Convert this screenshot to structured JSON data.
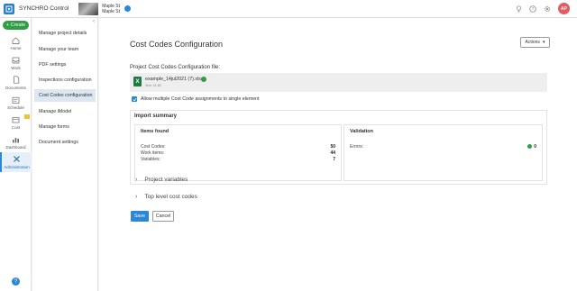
{
  "app": {
    "name": "SYNCHRO Control"
  },
  "project": {
    "line1": "Maple St",
    "line2": "Maple St"
  },
  "sidebar": {
    "create_label": "+ Create",
    "items": [
      {
        "label": "Home",
        "icon": "home-icon"
      },
      {
        "label": "Work",
        "icon": "inbox-icon"
      },
      {
        "label": "Documents",
        "icon": "document-icon"
      },
      {
        "label": "Schedule",
        "icon": "schedule-icon"
      },
      {
        "label": "Cost",
        "icon": "cost-icon"
      },
      {
        "label": "Dashboard",
        "icon": "dashboard-icon"
      },
      {
        "label": "Administration",
        "icon": "tools-icon"
      }
    ],
    "help_label": "?"
  },
  "submenu": {
    "items": [
      "Manage project details",
      "Manage your team",
      "PDF settings",
      "Inspections configuration",
      "Cost Codes configuration",
      "Manage iModel",
      "Manage forms",
      "Document settings"
    ]
  },
  "header": {
    "avatar_initials": "AP"
  },
  "main": {
    "title": "Cost Codes Configuration",
    "actions_label": "Actions",
    "file_label": "Project Cost Codes Configuration file:",
    "file_name": "example_14jul2021 (7).xlsx",
    "file_size": "Size: 41 kB",
    "checkbox_label": "Allow multiple Cost Code assignments to single element",
    "summary": {
      "title": "Import summary",
      "items_found": {
        "title": "Items found",
        "rows": [
          {
            "label": "Cost Codes:",
            "value": "50"
          },
          {
            "label": "Work items:",
            "value": "44"
          },
          {
            "label": "Variables:",
            "value": "7"
          }
        ]
      },
      "validation": {
        "title": "Validation",
        "errors_label": "Errors:",
        "errors_value": "0"
      }
    },
    "expanders": [
      "Project variables",
      "Top level cost codes"
    ],
    "save_label": "Save",
    "cancel_label": "Cancel"
  },
  "colors": {
    "accent": "#2b88d8",
    "success": "#2f9e44",
    "create": "#2f9e44",
    "avatar": "#e85a62"
  }
}
